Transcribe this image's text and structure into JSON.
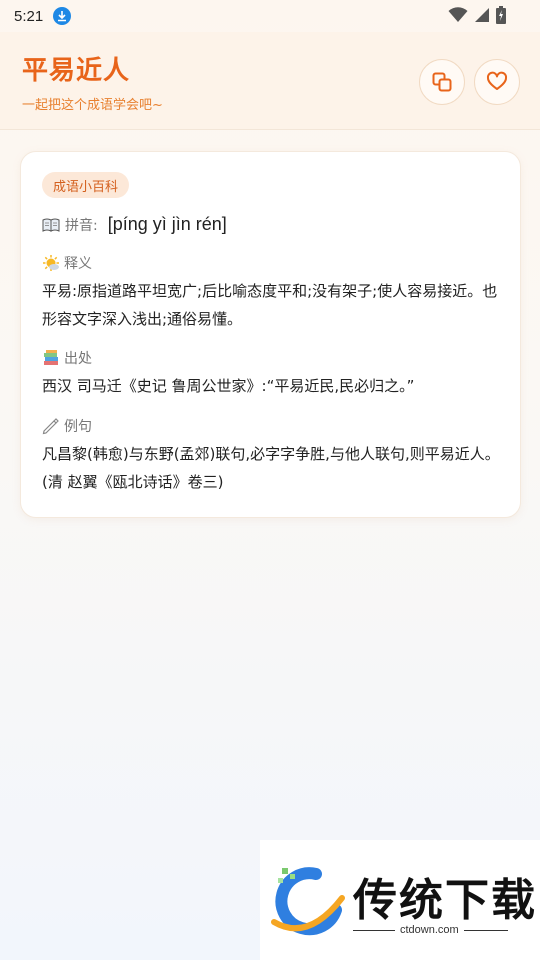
{
  "status_bar": {
    "time": "5:21"
  },
  "header": {
    "title": "平易近人",
    "subtitle": "一起把这个成语学会吧~"
  },
  "card": {
    "tag": "成语小百科",
    "pinyin_label": "拼音:",
    "pinyin_value": "[píng yì jìn rén]",
    "meaning_label": "释义",
    "meaning_text": "平易:原指道路平坦宽广;后比喻态度平和;没有架子;使人容易接近。也形容文字深入浅出;通俗易懂。",
    "source_label": "出处",
    "source_text": "西汉 司马迁《史记 鲁周公世家》:“平易近民,民必归之。”",
    "example_label": "例句",
    "example_text": "凡昌黎(韩愈)与东野(孟郊)联句,必字字争胜,与他人联句,则平易近人。(清 赵翼《瓯北诗话》卷三)"
  },
  "watermark": {
    "brand": "传统下载",
    "url": "ctdown.com"
  },
  "colors": {
    "accent": "#e8641a",
    "tag_bg": "#fce8d8",
    "header_bg": "#fdf3e9"
  },
  "icons": {
    "download": "download-icon",
    "wifi": "wifi-icon",
    "signal": "signal-icon",
    "battery": "battery-icon",
    "copy": "copy-icon",
    "favorite": "heart-icon",
    "pinyin": "book-icon",
    "meaning": "sun-icon",
    "source": "books-icon",
    "example": "pencil-icon"
  }
}
